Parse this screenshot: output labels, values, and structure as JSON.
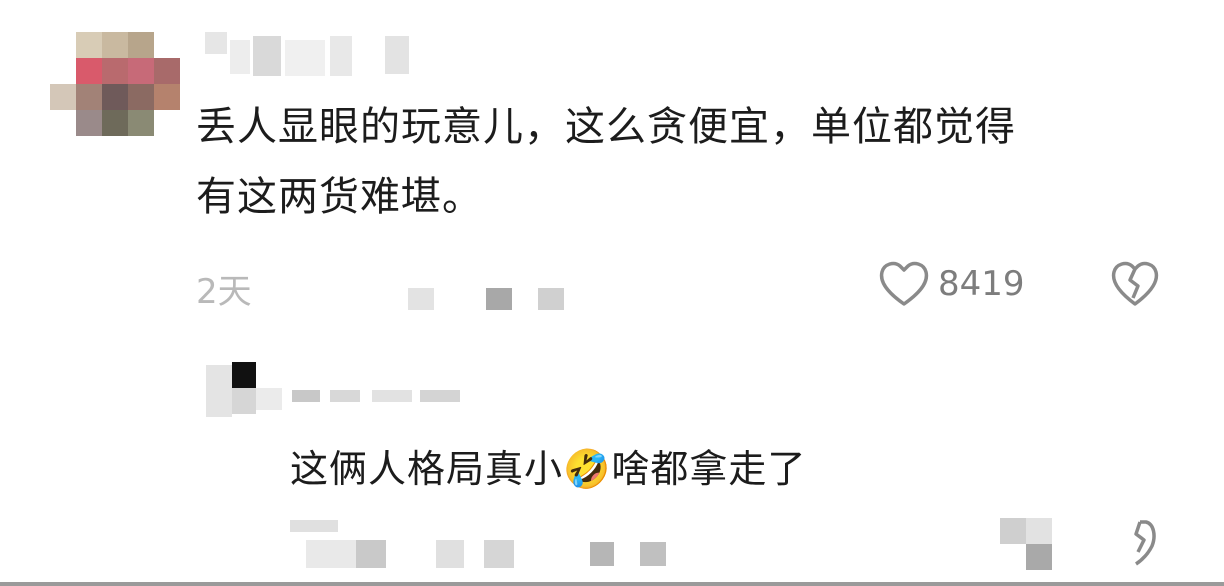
{
  "comment": {
    "text_line1": "丢人显眼的玩意儿，这么贪便宜，单位都觉得",
    "text_line2": "有这两货难堪。",
    "time_label": "2天",
    "like_count": "8419",
    "icons": {
      "like": "heart-outline-icon",
      "dislike": "broken-heart-icon"
    }
  },
  "reply": {
    "text_before_emoji": "这俩人格局真小",
    "emoji": "🤣",
    "text_after_emoji": "啥都拿走了",
    "icons": {
      "dislike": "broken-heart-icon"
    }
  },
  "colors": {
    "text": "#1c1c1c",
    "meta": "#b9b9b9",
    "icon": "#8a8a8a"
  }
}
